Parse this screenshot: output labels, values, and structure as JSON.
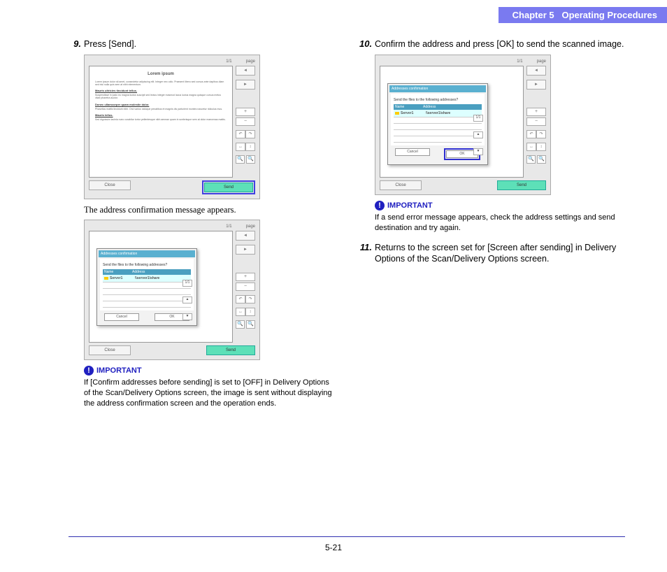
{
  "header": {
    "chapter": "Chapter 5",
    "title": "Operating Procedures"
  },
  "page_number": "5-21",
  "steps": {
    "s9": {
      "num": "9.",
      "text": "Press [Send].",
      "after": "The address confirmation message appears."
    },
    "s10": {
      "num": "10.",
      "text": "Confirm the address and press [OK] to send the scanned image."
    },
    "s11": {
      "num": "11.",
      "text": "Returns to the screen set for [Screen after sending] in Delivery Options of the Scan/Delivery Options screen."
    }
  },
  "important": {
    "label": "IMPORTANT",
    "left": "If [Confirm addresses before sending] is set to [OFF] in Delivery Options of the Scan/Delivery Options screen, the image is sent without displaying the address confirmation screen and the operation ends.",
    "right": "If a send error message appears, check the address settings and send destination and try again."
  },
  "screenshot": {
    "page_indicator": "1/1",
    "page_label": "page",
    "close": "Close",
    "send": "Send",
    "doc_title": "Lorem ipsum",
    "dialog": {
      "title": "Addresses confirmation",
      "msg": "Send the files to the following addresses?",
      "col_name": "Name",
      "col_address": "Address",
      "row_name": "Server1",
      "row_addr": "\\\\server1\\share",
      "side_page": "1/1",
      "cancel": "Cancel",
      "ok": "OK"
    }
  }
}
